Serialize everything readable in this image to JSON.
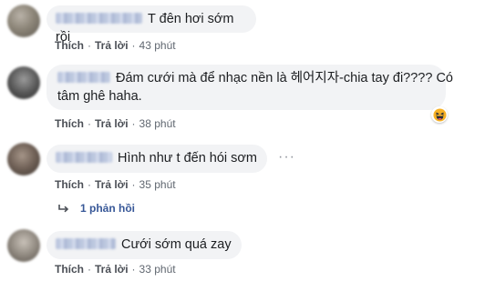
{
  "comments": [
    {
      "text": "T đên hơi sớm rồi",
      "like": "Thích",
      "reply": "Trả lời",
      "time": "43 phút"
    },
    {
      "text_line1": "Đám cưới mà để nhạc nền là 헤어지자-chia tay đi???? Có",
      "text_line2": "tâm ghê haha.",
      "like": "Thích",
      "reply": "Trả lời",
      "time": "38 phút",
      "reaction_icon": "haha-emoji-icon"
    },
    {
      "text": "Hình như t đến hói sơm",
      "like": "Thích",
      "reply": "Trả lời",
      "time": "35 phút",
      "more_icon": "more-options-icon"
    },
    {
      "text": "Cưới sớm quá zay",
      "like": "Thích",
      "reply": "Trả lời",
      "time": "33 phút"
    }
  ],
  "replies_link": "1 phản hồi",
  "colors": {
    "bubble": "#f2f3f5",
    "link": "#385898",
    "meta": "#606770",
    "reaction_yellow": "#f7b125"
  }
}
